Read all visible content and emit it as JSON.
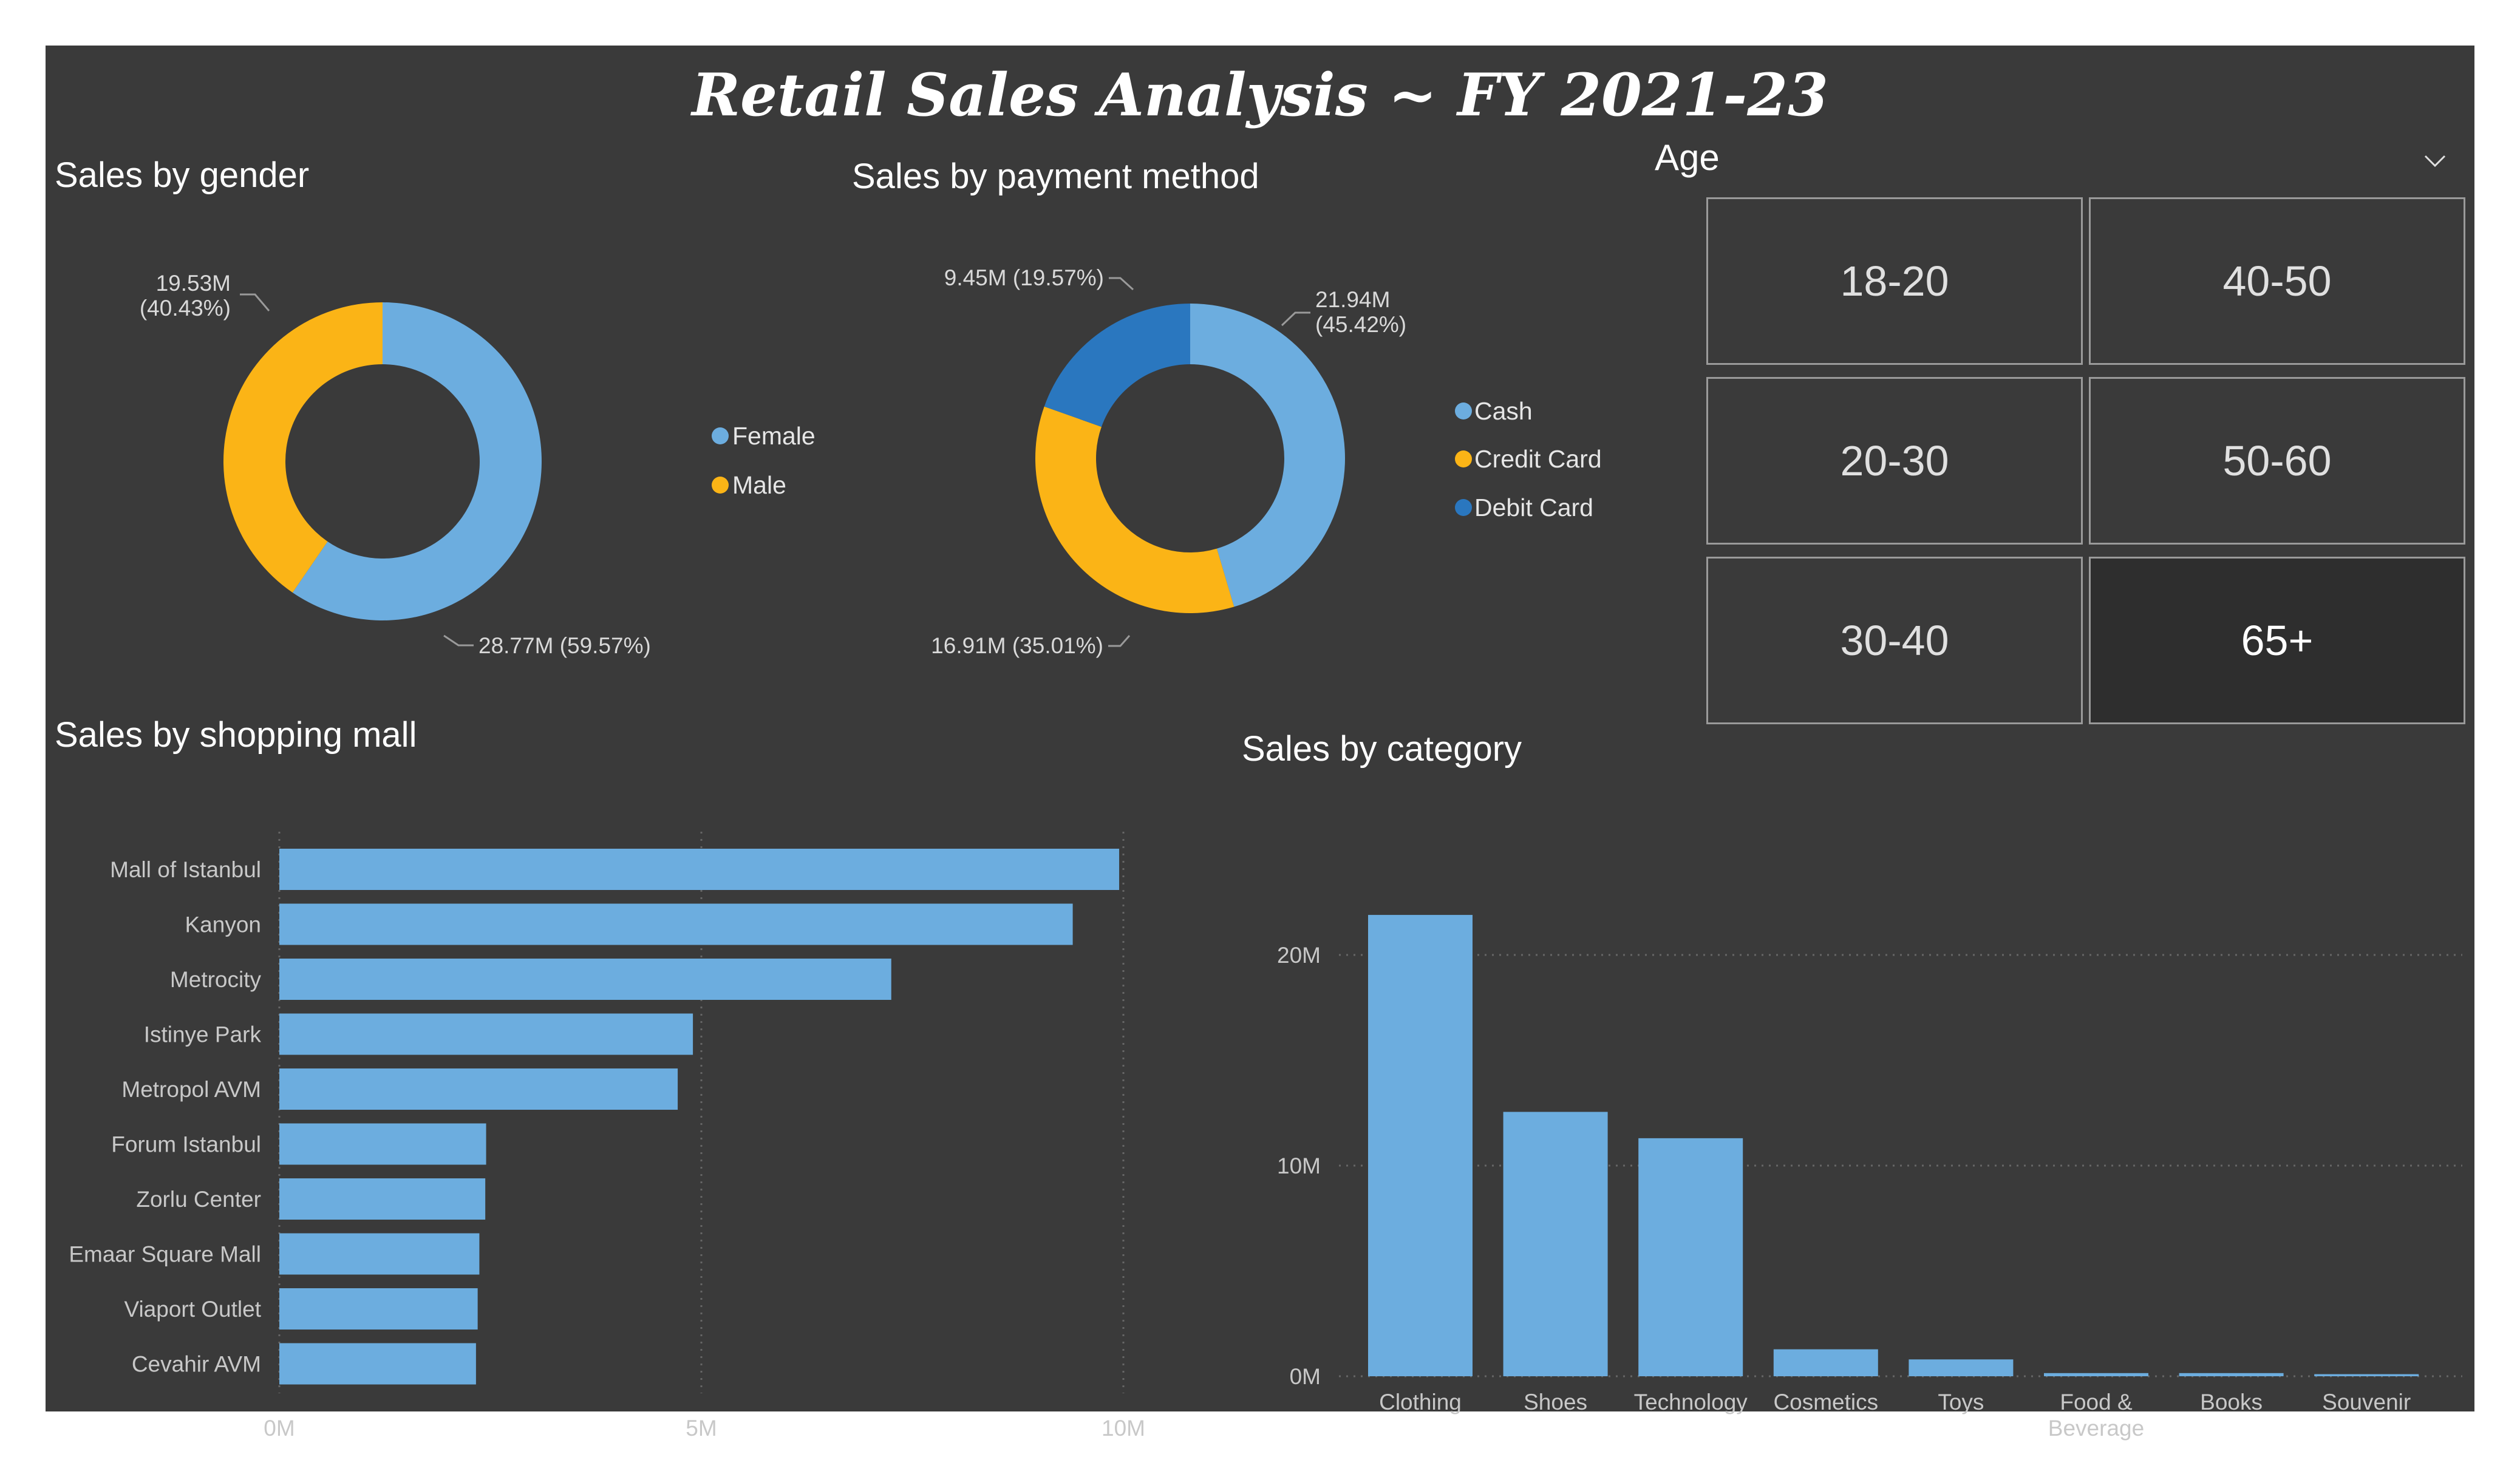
{
  "report_title": "Retail Sales Analysis  ~  FY 2021-23",
  "gender_panel": {
    "title": "Sales by gender",
    "legend": [
      {
        "label": "Female",
        "color": "#6caddf"
      },
      {
        "label": "Male",
        "color": "#fbb416"
      }
    ],
    "labels": {
      "male": [
        "19.53M",
        "(40.43%)"
      ],
      "female": "28.77M (59.57%)"
    }
  },
  "payment_panel": {
    "title": "Sales by payment method",
    "legend": [
      {
        "label": "Cash",
        "color": "#6caddf"
      },
      {
        "label": "Credit Card",
        "color": "#fbb416"
      },
      {
        "label": "Debit Card",
        "color": "#2a77bf"
      }
    ],
    "labels": {
      "cash": [
        "21.94M",
        "(45.42%)"
      ],
      "credit": "16.91M (35.01%)",
      "debit": "9.45M (19.57%)"
    }
  },
  "age_slicer": {
    "header": "Age",
    "chevron_icon": "chevron-down-icon",
    "options": [
      "18-20",
      "40-50",
      "20-30",
      "50-60",
      "30-40",
      "65+"
    ],
    "selected": "65+"
  },
  "mall_panel": {
    "title": "Sales by shopping mall"
  },
  "category_panel": {
    "title": "Sales by category"
  },
  "chart_data": [
    {
      "type": "pie",
      "categories": [
        "Female",
        "Male"
      ],
      "values": [
        28.77,
        19.53
      ],
      "percentages": [
        59.57,
        40.43
      ],
      "unit": "M",
      "legend_position": "right"
    },
    {
      "type": "pie",
      "categories": [
        "Cash",
        "Credit Card",
        "Debit Card"
      ],
      "values": [
        21.94,
        16.91,
        9.45
      ],
      "percentages": [
        45.42,
        35.01,
        19.57
      ],
      "unit": "M",
      "legend_position": "right"
    },
    {
      "type": "bar",
      "orientation": "horizontal",
      "categories": [
        "Mall of Istanbul",
        "Kanyon",
        "Metrocity",
        "Istinye Park",
        "Metropol AVM",
        "Forum Istanbul",
        "Zorlu Center",
        "Emaar Square Mall",
        "Viaport Outlet",
        "Cevahir AVM"
      ],
      "values": [
        9.95,
        9.4,
        7.25,
        4.9,
        4.72,
        2.45,
        2.44,
        2.37,
        2.35,
        2.33
      ],
      "unit": "M",
      "xlim": [
        0,
        10
      ],
      "ticks": [
        "0M",
        "5M",
        "10M"
      ],
      "grid": true,
      "color": "#6caddf"
    },
    {
      "type": "bar",
      "orientation": "vertical",
      "categories": [
        [
          "Clothing"
        ],
        [
          "Shoes"
        ],
        [
          "Technology"
        ],
        [
          "Cosmetics"
        ],
        [
          "Toys"
        ],
        [
          "Food &",
          "Beverage"
        ],
        [
          "Books"
        ],
        [
          "Souvenir"
        ]
      ],
      "values": [
        21.9,
        12.55,
        11.3,
        1.28,
        0.8,
        0.15,
        0.15,
        0.1
      ],
      "unit": "M",
      "ylim": [
        0,
        20
      ],
      "ticks": [
        "0M",
        "10M",
        "20M"
      ],
      "grid": true,
      "color": "#6caddf"
    }
  ]
}
